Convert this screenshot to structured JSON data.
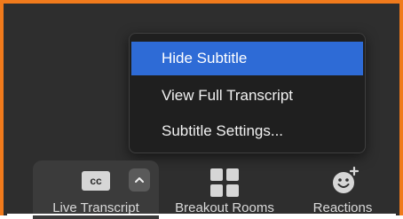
{
  "popup_menu": {
    "items": [
      {
        "label": "Hide Subtitle",
        "selected": true
      },
      {
        "label": "View Full Transcript",
        "selected": false
      },
      {
        "label": "Subtitle Settings...",
        "selected": false
      }
    ]
  },
  "toolbar": {
    "live_transcript": {
      "label": "Live Transcript",
      "badge": "cc",
      "icon": "closed-caption-icon",
      "caret_icon": "chevron-up-icon"
    },
    "breakout_rooms": {
      "label": "Breakout Rooms",
      "icon": "grid-squares-icon"
    },
    "reactions": {
      "label": "Reactions",
      "icon": "smiley-plus-icon"
    }
  },
  "colors": {
    "frame_border": "#f07a1c",
    "background": "#2e2e2e",
    "menu_selected": "#2e6bd6"
  }
}
